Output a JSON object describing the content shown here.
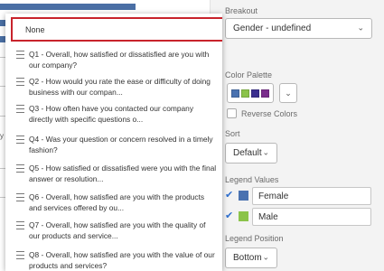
{
  "left_panel": {
    "fragment_text": "y V"
  },
  "dropdown": {
    "none_label": "None",
    "options": [
      {
        "label": "Q1 - Overall, how satisfied or dissatisfied are you with our company?"
      },
      {
        "label": "Q2 - How would you rate the ease or difficulty of doing business with our compan..."
      },
      {
        "label": "Q3 - How often have you contacted our company directly with specific questions o..."
      },
      {
        "label": "Q4 - Was your question or concern resolved in a timely fashion?"
      },
      {
        "label": "Q5 - How satisfied or dissatisfied were you with the final answer or resolution..."
      },
      {
        "label": "Q6 - Overall, how satisfied are you with the products and services offered by ou..."
      },
      {
        "label": "Q7 - Overall, how satisfied are you with the quality of our products and service..."
      },
      {
        "label": "Q8 - Overall, how satisfied are you with the value of our products and services?"
      }
    ]
  },
  "settings": {
    "breakout_label": "Breakout",
    "breakout_value": "Gender - undefined",
    "color_palette_label": "Color Palette",
    "palette_colors": [
      "#4a72b0",
      "#8bc34a",
      "#3b2f8f",
      "#7a2d8c"
    ],
    "reverse_colors_label": "Reverse Colors",
    "sort_label": "Sort",
    "sort_value": "Default",
    "legend_values_label": "Legend Values",
    "legend_values": [
      {
        "name": "Female",
        "color": "#4a72b0",
        "checked": true
      },
      {
        "name": "Male",
        "color": "#8bc34a",
        "checked": true
      }
    ],
    "legend_position_label": "Legend Position",
    "legend_position_value": "Bottom"
  }
}
